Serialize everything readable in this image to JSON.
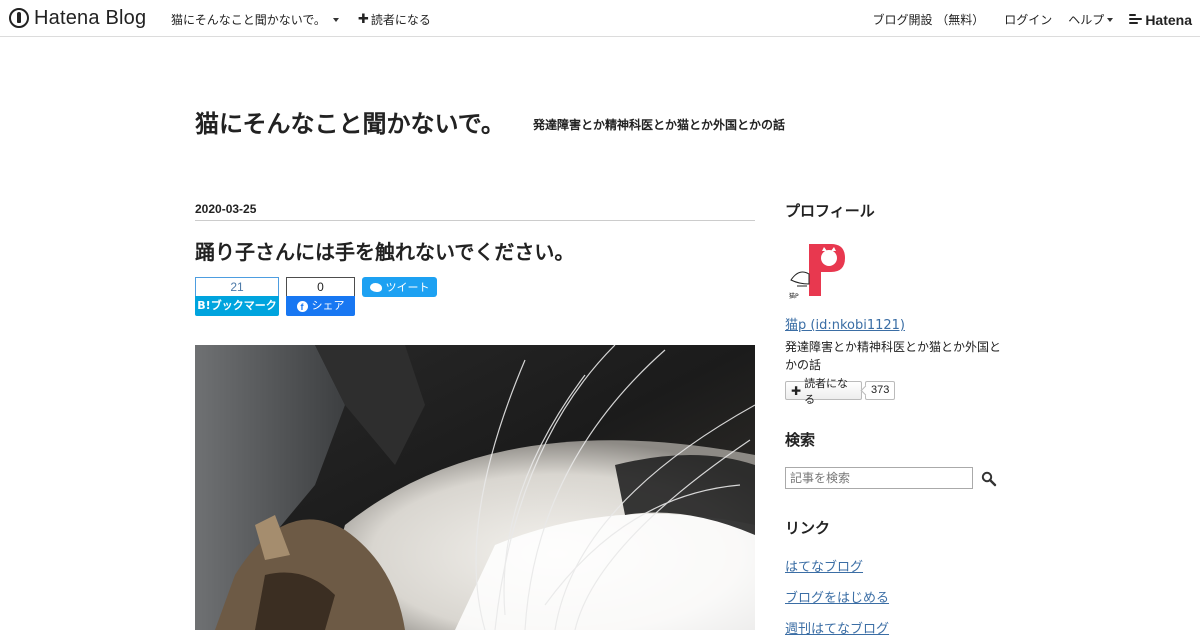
{
  "topbar": {
    "logo_text": "Hatena Blog",
    "blog_menu_label": "猫にそんなこと聞かないで。",
    "subscribe_label": "読者になる",
    "open_blog_label": "ブログ開設 （無料）",
    "login_label": "ログイン",
    "help_label": "ヘルプ",
    "hatena_label": "Hatena"
  },
  "blog": {
    "title": "猫にそんなこと聞かないで。",
    "description": "発達障害とか精神科医とか猫とか外国とかの話"
  },
  "entry": {
    "date": "2020-03-25",
    "title": "踊り子さんには手を触れないでください。",
    "bookmark_count": "21",
    "bookmark_label": "B!ブックマーク",
    "facebook_count": "0",
    "facebook_label": "シェア",
    "tweet_label": "ツイート"
  },
  "sidebar": {
    "profile_heading": "プロフィール",
    "profile_link": "猫p (id:nkobi1121)",
    "profile_desc": "発達障害とか精神科医とか猫とか外国とかの話",
    "subscribe_label": "読者になる",
    "subscriber_count": "373",
    "search_heading": "検索",
    "search_placeholder": "記事を検索",
    "links_heading": "リンク",
    "links": [
      "はてなブログ",
      "ブログをはじめる",
      "週刊はてなブログ"
    ]
  },
  "colors": {
    "link": "#3b6ea5",
    "bookmark_blue": "#00a4de",
    "facebook_blue": "#1877f2",
    "twitter_blue": "#1da1f2",
    "avatar_red": "#e8384f"
  }
}
